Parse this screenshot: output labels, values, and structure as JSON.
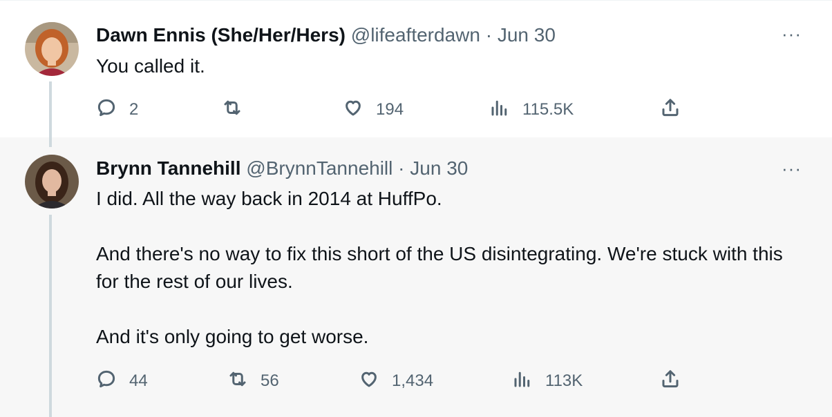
{
  "tweets": [
    {
      "display_name": "Dawn Ennis (She/Her/Hers)",
      "handle": "@lifeafterdawn",
      "separator": "·",
      "date": "Jun 30",
      "more": "···",
      "paragraphs": [
        "You called it."
      ],
      "metrics": {
        "replies": "2",
        "retweets": "",
        "likes": "194",
        "views": "115.5K"
      }
    },
    {
      "display_name": "Brynn Tannehill",
      "handle": "@BrynnTannehill",
      "separator": "·",
      "date": "Jun 30",
      "more": "···",
      "paragraphs": [
        "I did. All the way back in 2014 at HuffPo.",
        "And there's no way to fix this short of the US disintegrating. We're stuck with this for the rest of our lives.",
        "And it's only going to get worse."
      ],
      "metrics": {
        "replies": "44",
        "retweets": "56",
        "likes": "1,434",
        "views": "113K"
      }
    }
  ],
  "icons": {
    "reply": "reply-icon",
    "retweet": "retweet-icon",
    "like": "like-icon",
    "views": "views-icon",
    "share": "share-icon"
  },
  "colors": {
    "text": "#0f1419",
    "secondary": "#536471",
    "thread_line": "#cfd9de",
    "highlight_bg": "#f7f7f7"
  }
}
